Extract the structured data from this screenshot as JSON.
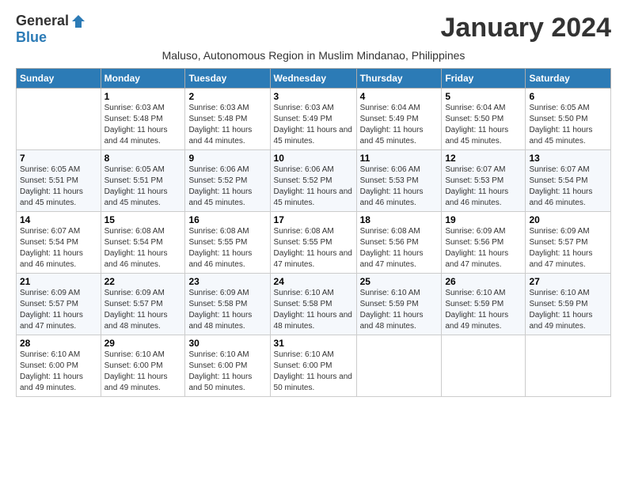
{
  "header": {
    "logo_general": "General",
    "logo_blue": "Blue",
    "month_title": "January 2024",
    "subtitle": "Maluso, Autonomous Region in Muslim Mindanao, Philippines"
  },
  "columns": [
    "Sunday",
    "Monday",
    "Tuesday",
    "Wednesday",
    "Thursday",
    "Friday",
    "Saturday"
  ],
  "weeks": [
    [
      {
        "day": "",
        "sunrise": "",
        "sunset": "",
        "daylight": ""
      },
      {
        "day": "1",
        "sunrise": "Sunrise: 6:03 AM",
        "sunset": "Sunset: 5:48 PM",
        "daylight": "Daylight: 11 hours and 44 minutes."
      },
      {
        "day": "2",
        "sunrise": "Sunrise: 6:03 AM",
        "sunset": "Sunset: 5:48 PM",
        "daylight": "Daylight: 11 hours and 44 minutes."
      },
      {
        "day": "3",
        "sunrise": "Sunrise: 6:03 AM",
        "sunset": "Sunset: 5:49 PM",
        "daylight": "Daylight: 11 hours and 45 minutes."
      },
      {
        "day": "4",
        "sunrise": "Sunrise: 6:04 AM",
        "sunset": "Sunset: 5:49 PM",
        "daylight": "Daylight: 11 hours and 45 minutes."
      },
      {
        "day": "5",
        "sunrise": "Sunrise: 6:04 AM",
        "sunset": "Sunset: 5:50 PM",
        "daylight": "Daylight: 11 hours and 45 minutes."
      },
      {
        "day": "6",
        "sunrise": "Sunrise: 6:05 AM",
        "sunset": "Sunset: 5:50 PM",
        "daylight": "Daylight: 11 hours and 45 minutes."
      }
    ],
    [
      {
        "day": "7",
        "sunrise": "Sunrise: 6:05 AM",
        "sunset": "Sunset: 5:51 PM",
        "daylight": "Daylight: 11 hours and 45 minutes."
      },
      {
        "day": "8",
        "sunrise": "Sunrise: 6:05 AM",
        "sunset": "Sunset: 5:51 PM",
        "daylight": "Daylight: 11 hours and 45 minutes."
      },
      {
        "day": "9",
        "sunrise": "Sunrise: 6:06 AM",
        "sunset": "Sunset: 5:52 PM",
        "daylight": "Daylight: 11 hours and 45 minutes."
      },
      {
        "day": "10",
        "sunrise": "Sunrise: 6:06 AM",
        "sunset": "Sunset: 5:52 PM",
        "daylight": "Daylight: 11 hours and 45 minutes."
      },
      {
        "day": "11",
        "sunrise": "Sunrise: 6:06 AM",
        "sunset": "Sunset: 5:53 PM",
        "daylight": "Daylight: 11 hours and 46 minutes."
      },
      {
        "day": "12",
        "sunrise": "Sunrise: 6:07 AM",
        "sunset": "Sunset: 5:53 PM",
        "daylight": "Daylight: 11 hours and 46 minutes."
      },
      {
        "day": "13",
        "sunrise": "Sunrise: 6:07 AM",
        "sunset": "Sunset: 5:54 PM",
        "daylight": "Daylight: 11 hours and 46 minutes."
      }
    ],
    [
      {
        "day": "14",
        "sunrise": "Sunrise: 6:07 AM",
        "sunset": "Sunset: 5:54 PM",
        "daylight": "Daylight: 11 hours and 46 minutes."
      },
      {
        "day": "15",
        "sunrise": "Sunrise: 6:08 AM",
        "sunset": "Sunset: 5:54 PM",
        "daylight": "Daylight: 11 hours and 46 minutes."
      },
      {
        "day": "16",
        "sunrise": "Sunrise: 6:08 AM",
        "sunset": "Sunset: 5:55 PM",
        "daylight": "Daylight: 11 hours and 46 minutes."
      },
      {
        "day": "17",
        "sunrise": "Sunrise: 6:08 AM",
        "sunset": "Sunset: 5:55 PM",
        "daylight": "Daylight: 11 hours and 47 minutes."
      },
      {
        "day": "18",
        "sunrise": "Sunrise: 6:08 AM",
        "sunset": "Sunset: 5:56 PM",
        "daylight": "Daylight: 11 hours and 47 minutes."
      },
      {
        "day": "19",
        "sunrise": "Sunrise: 6:09 AM",
        "sunset": "Sunset: 5:56 PM",
        "daylight": "Daylight: 11 hours and 47 minutes."
      },
      {
        "day": "20",
        "sunrise": "Sunrise: 6:09 AM",
        "sunset": "Sunset: 5:57 PM",
        "daylight": "Daylight: 11 hours and 47 minutes."
      }
    ],
    [
      {
        "day": "21",
        "sunrise": "Sunrise: 6:09 AM",
        "sunset": "Sunset: 5:57 PM",
        "daylight": "Daylight: 11 hours and 47 minutes."
      },
      {
        "day": "22",
        "sunrise": "Sunrise: 6:09 AM",
        "sunset": "Sunset: 5:57 PM",
        "daylight": "Daylight: 11 hours and 48 minutes."
      },
      {
        "day": "23",
        "sunrise": "Sunrise: 6:09 AM",
        "sunset": "Sunset: 5:58 PM",
        "daylight": "Daylight: 11 hours and 48 minutes."
      },
      {
        "day": "24",
        "sunrise": "Sunrise: 6:10 AM",
        "sunset": "Sunset: 5:58 PM",
        "daylight": "Daylight: 11 hours and 48 minutes."
      },
      {
        "day": "25",
        "sunrise": "Sunrise: 6:10 AM",
        "sunset": "Sunset: 5:59 PM",
        "daylight": "Daylight: 11 hours and 48 minutes."
      },
      {
        "day": "26",
        "sunrise": "Sunrise: 6:10 AM",
        "sunset": "Sunset: 5:59 PM",
        "daylight": "Daylight: 11 hours and 49 minutes."
      },
      {
        "day": "27",
        "sunrise": "Sunrise: 6:10 AM",
        "sunset": "Sunset: 5:59 PM",
        "daylight": "Daylight: 11 hours and 49 minutes."
      }
    ],
    [
      {
        "day": "28",
        "sunrise": "Sunrise: 6:10 AM",
        "sunset": "Sunset: 6:00 PM",
        "daylight": "Daylight: 11 hours and 49 minutes."
      },
      {
        "day": "29",
        "sunrise": "Sunrise: 6:10 AM",
        "sunset": "Sunset: 6:00 PM",
        "daylight": "Daylight: 11 hours and 49 minutes."
      },
      {
        "day": "30",
        "sunrise": "Sunrise: 6:10 AM",
        "sunset": "Sunset: 6:00 PM",
        "daylight": "Daylight: 11 hours and 50 minutes."
      },
      {
        "day": "31",
        "sunrise": "Sunrise: 6:10 AM",
        "sunset": "Sunset: 6:00 PM",
        "daylight": "Daylight: 11 hours and 50 minutes."
      },
      {
        "day": "",
        "sunrise": "",
        "sunset": "",
        "daylight": ""
      },
      {
        "day": "",
        "sunrise": "",
        "sunset": "",
        "daylight": ""
      },
      {
        "day": "",
        "sunrise": "",
        "sunset": "",
        "daylight": ""
      }
    ]
  ]
}
